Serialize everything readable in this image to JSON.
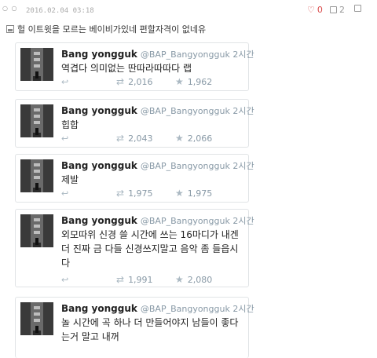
{
  "header": {
    "dots": "○ ○",
    "date": "2016.02.04 03:18",
    "likes": "0",
    "dislikes": "2",
    "comments": ""
  },
  "comment": {
    "text": "헐 이트윗을 모르는 베이비가있네 편할자격이 없네유"
  },
  "tweets": [
    {
      "name": "Bang yongguk",
      "handle": "@BAP_Bangyongguk 2시간",
      "text": "역겹다 의미없는 딴따라따따다 랩",
      "retweets": "2,016",
      "favorites": "1,962"
    },
    {
      "name": "Bang yongguk",
      "handle": "@BAP_Bangyongguk 2시간",
      "text": "힙합",
      "retweets": "2,043",
      "favorites": "2,066"
    },
    {
      "name": "Bang yongguk",
      "handle": "@BAP_Bangyongguk 2시간",
      "text": "제발",
      "retweets": "1,975",
      "favorites": "1,975"
    },
    {
      "name": "Bang yongguk",
      "handle": "@BAP_Bangyongguk 2시간",
      "text": "외모따위 신경 쓸 시간에 쓰는 16마디가 내겐 더 진짜 금 다들 신경쓰지말고 음악 좀 들읍시다",
      "retweets": "1,991",
      "favorites": "2,080"
    },
    {
      "name": "Bang yongguk",
      "handle": "@BAP_Bangyongguk 2시간",
      "text": "놀 시간에 곡 하나 더 만들어야지 남들이 좋다는거 말고 내꺼",
      "retweets": "",
      "favorites": ""
    }
  ],
  "icons": {
    "like": "thumbs-up-icon",
    "dislike": "thumbs-down-icon",
    "comment": "comment-icon",
    "reply": "reply-icon",
    "retweet": "retweet-icon",
    "favorite": "star-icon"
  },
  "colors": {
    "like": "#d94a4a",
    "muted": "#8899a6",
    "border": "#e1e4e6"
  }
}
